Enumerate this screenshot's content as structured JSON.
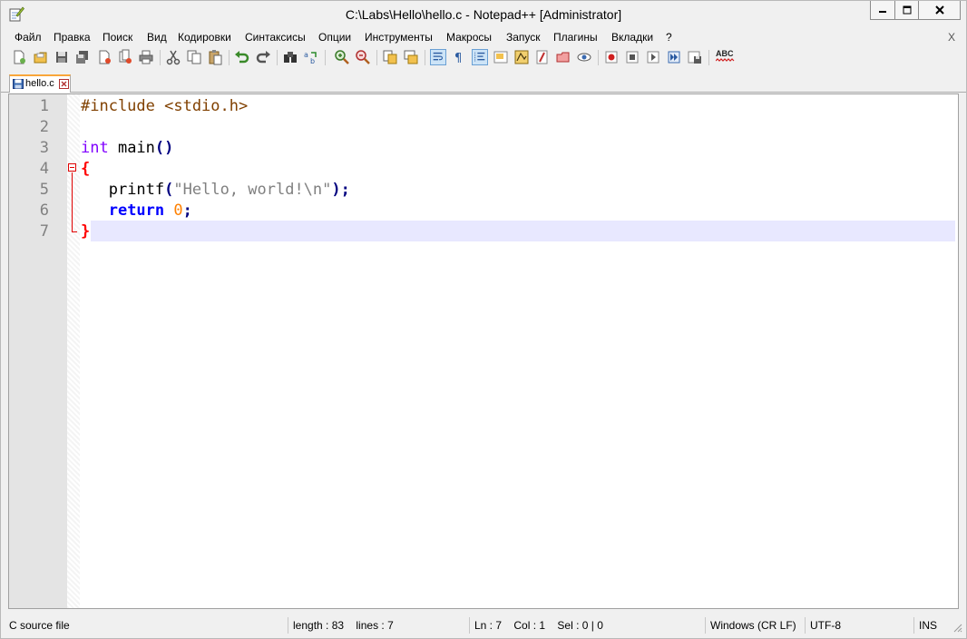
{
  "window": {
    "title": "C:\\Labs\\Hello\\hello.c - Notepad++ [Administrator]"
  },
  "menu": {
    "items": [
      "Файл",
      "Правка",
      "Поиск",
      "Вид",
      "Кодировки",
      "Синтаксисы",
      "Опции",
      "Инструменты",
      "Макросы",
      "Запуск",
      "Плагины",
      "Вкладки",
      "?"
    ],
    "close_doc": "X"
  },
  "toolbar": {
    "icons": [
      "new-file-icon",
      "open-file-icon",
      "save-icon",
      "save-all-icon",
      "close-icon",
      "close-all-icon",
      "print-icon",
      "cut-icon",
      "copy-icon",
      "paste-icon",
      "undo-icon",
      "redo-icon",
      "find-icon",
      "replace-icon",
      "zoom-in-icon",
      "zoom-out-icon",
      "sync-vertical-icon",
      "sync-horizontal-icon",
      "word-wrap-icon",
      "show-all-chars-icon",
      "indent-guide-icon",
      "language-icon",
      "doc-map-icon",
      "function-list-icon",
      "folder-workspace-icon",
      "monitor-icon",
      "record-macro-icon",
      "stop-macro-icon",
      "play-macro-icon",
      "run-macro-multiple-icon",
      "save-macro-icon",
      "spell-check-icon"
    ],
    "spellcheck_label": "ABC"
  },
  "tabs": [
    {
      "label": "hello.c"
    }
  ],
  "editor": {
    "line_numbers": [
      "1",
      "2",
      "3",
      "4",
      "5",
      "6",
      "7"
    ],
    "lines": {
      "l1_pre": "#include <stdio.h>",
      "l3_type": "int",
      "l3_name": " main",
      "l3_parens": "()",
      "l4_brace": "{",
      "l5_indent": "   ",
      "l5_func": "printf",
      "l5_open": "(",
      "l5_str": "\"Hello, world!\\n\"",
      "l5_close": ");",
      "l6_kw": "return",
      "l6_sp": " ",
      "l6_num": "0",
      "l6_semi": ";",
      "l7_brace": "}"
    },
    "current_line": 7
  },
  "status": {
    "file_type": "C source file",
    "length": "length : 83",
    "lines": "lines : 7",
    "ln": "Ln : 7",
    "col": "Col : 1",
    "sel": "Sel : 0 | 0",
    "eol": "Windows (CR LF)",
    "encoding": "UTF-8",
    "mode": "INS"
  },
  "colors": {
    "keyword": "#0000ff",
    "type": "#8000ff",
    "preprocessor": "#804000",
    "string": "#808080",
    "number": "#ff8000",
    "operator": "#000080",
    "brace_match": "#ff0000",
    "current_line": "#e8e8ff",
    "tab_accent": "#f9a63a"
  }
}
